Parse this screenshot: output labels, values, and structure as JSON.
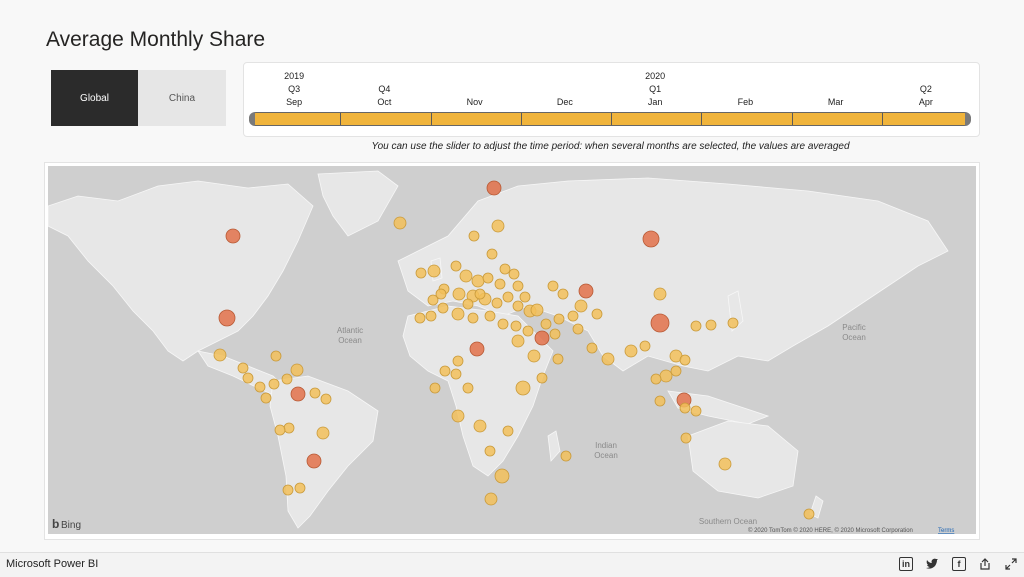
{
  "page": {
    "title": "Average Monthly Share"
  },
  "toggle": {
    "options": [
      "Global",
      "China"
    ],
    "selected": "Global"
  },
  "slider": {
    "years": [
      {
        "label": "2019",
        "col": 0
      },
      {
        "label": "2020",
        "col": 4
      }
    ],
    "quarters": [
      {
        "label": "Q3",
        "col": 0
      },
      {
        "label": "Q4",
        "col": 1
      },
      {
        "label": "Q1",
        "col": 4
      },
      {
        "label": "Q2",
        "col": 7
      }
    ],
    "months": [
      "Sep",
      "Oct",
      "Nov",
      "Dec",
      "Jan",
      "Feb",
      "Mar",
      "Apr"
    ],
    "hint": "You can use the slider to adjust the time period: when several months are selected, the values are averaged"
  },
  "map": {
    "ocean_labels": [
      {
        "text": "Atlantic\nOcean",
        "key": "atlantic"
      },
      {
        "text": "Pacific\nOcean",
        "key": "pacific"
      },
      {
        "text": "Indian\nOcean",
        "key": "indian"
      },
      {
        "text": "Southern Ocean",
        "key": "southern"
      }
    ],
    "bing_label": "Bing",
    "attribution": "© 2020 TomTom © 2020 HERE, © 2020 Microsoft Corporation",
    "terms_label": "Terms",
    "colors": {
      "low": "#f2c05a",
      "high": "#e2714a",
      "land": "#e7e7e7",
      "water": "#cfcfcf"
    }
  },
  "footer": {
    "brand": "Microsoft Power BI",
    "icons": [
      "linkedin-icon",
      "twitter-icon",
      "facebook-icon",
      "share-icon",
      "fullscreen-icon"
    ]
  }
}
